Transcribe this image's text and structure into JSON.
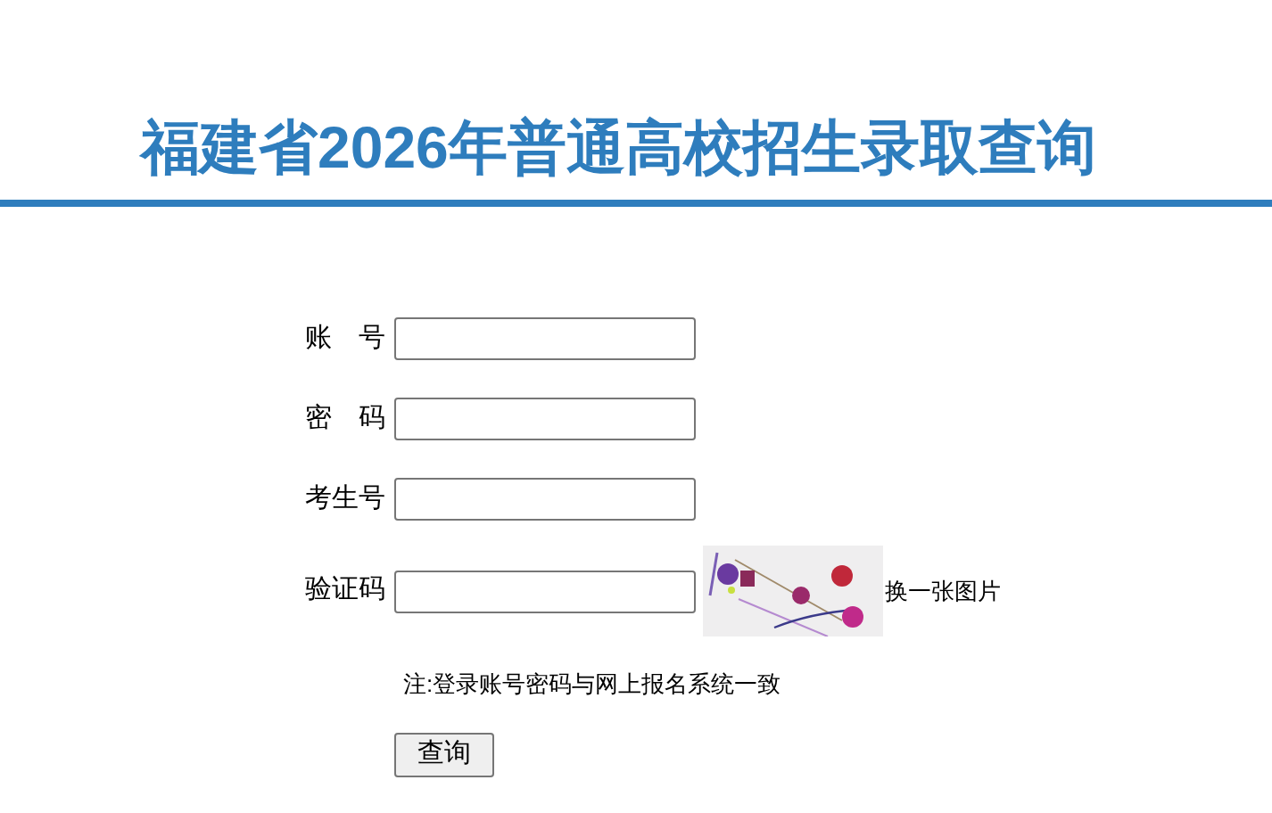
{
  "header": {
    "title": "福建省2026年普通高校招生录取查询"
  },
  "form": {
    "fields": [
      {
        "label": "账　号",
        "kind": "text"
      },
      {
        "label": "密　码",
        "kind": "password"
      },
      {
        "label": "考生号",
        "kind": "text"
      },
      {
        "label": "验证码",
        "kind": "captcha",
        "refresh_link": "换一张图片"
      }
    ],
    "note": "注:登录账号密码与网上报名系统一致",
    "submit": "查询"
  }
}
